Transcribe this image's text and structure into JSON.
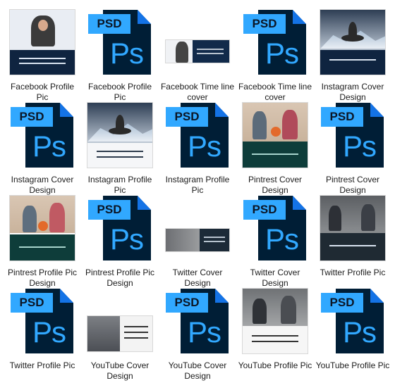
{
  "files": [
    {
      "label": "Facebook Profile Pic",
      "type": "image"
    },
    {
      "label": "Facebook Profile Pic",
      "type": "psd"
    },
    {
      "label": "Facebook Time line cover",
      "type": "image"
    },
    {
      "label": "Facebook Time line cover",
      "type": "psd"
    },
    {
      "label": "Instagram Cover Design",
      "type": "image"
    },
    {
      "label": "Instagram Cover Design",
      "type": "psd"
    },
    {
      "label": "Instagram Profile Pic",
      "type": "image"
    },
    {
      "label": "Instagram Profile Pic",
      "type": "psd"
    },
    {
      "label": "Pintrest Cover Design",
      "type": "image"
    },
    {
      "label": "Pintrest Cover Design",
      "type": "psd"
    },
    {
      "label": "Pintrest Profile Pic Design",
      "type": "image"
    },
    {
      "label": "Pintrest Profile Pic Design",
      "type": "psd"
    },
    {
      "label": "Twitter Cover Design",
      "type": "image"
    },
    {
      "label": "Twitter Cover Design",
      "type": "psd"
    },
    {
      "label": "Twitter Profile Pic",
      "type": "image"
    },
    {
      "label": "Twitter Profile Pic",
      "type": "psd"
    },
    {
      "label": "YouTube Cover Design",
      "type": "image"
    },
    {
      "label": "YouTube Cover Design",
      "type": "psd"
    },
    {
      "label": "YouTube Profile Pic",
      "type": "image"
    },
    {
      "label": "YouTube Profile Pic",
      "type": "psd"
    }
  ],
  "psd_icon": {
    "tag": "PSD",
    "glyph": "Ps"
  },
  "colors": {
    "psd_dark": "#001e36",
    "psd_blue": "#31a8ff",
    "psd_fold": "#1473e6"
  }
}
